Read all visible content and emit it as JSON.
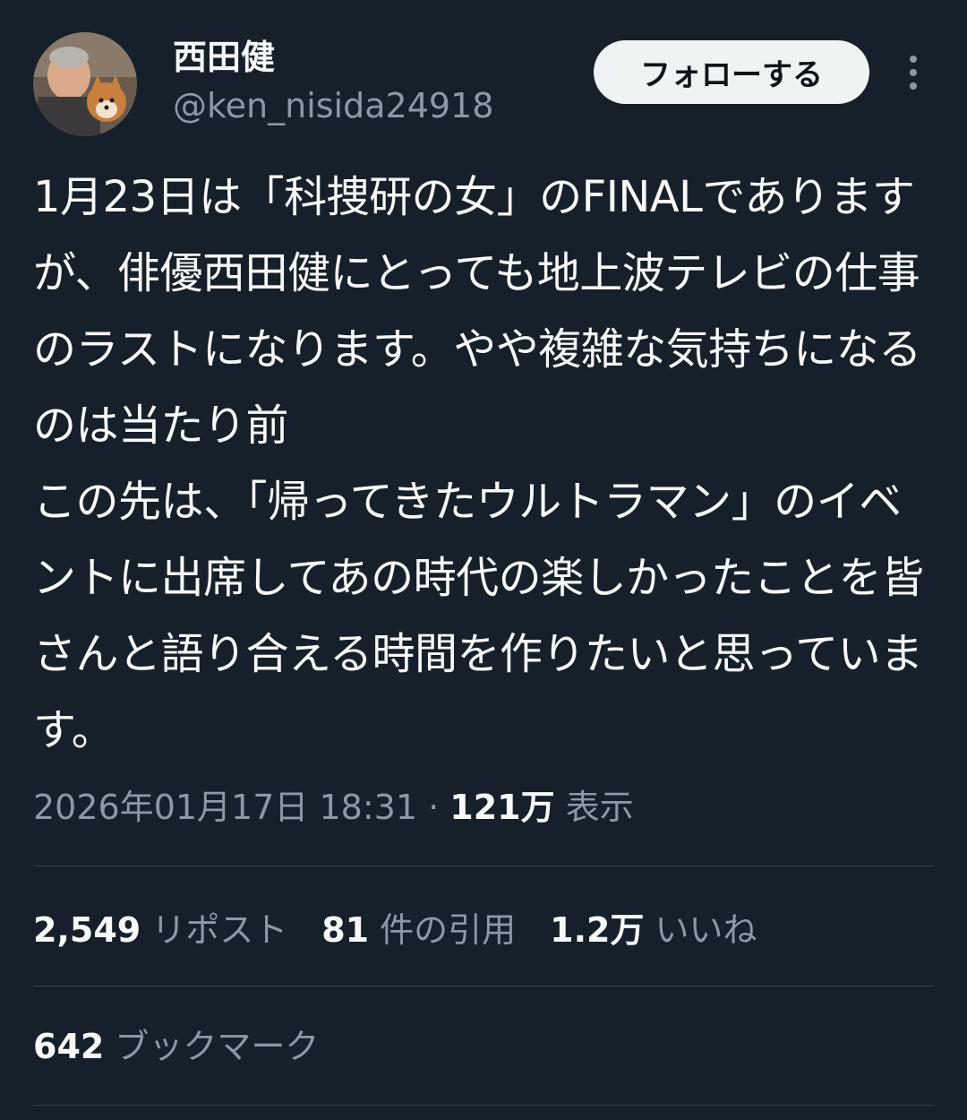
{
  "author": {
    "display_name": "西田健",
    "handle": "@ken_nisida24918",
    "avatar_icon": "profile-photo-with-dog"
  },
  "actions": {
    "follow_label": "フォローする",
    "more_icon": "more-vertical-icon"
  },
  "tweet": {
    "text": "1月23日は「科捜研の女」のFINALでありますが、俳優西田健にとっても地上波テレビの仕事のラストになります。やや複雑な気持ちになるのは当たり前\nこの先は、「帰ってきたウルトラマン」のイベントに出席してあの時代の楽しかったことを皆さんと語り合える時間を作りたいと思っています。"
  },
  "meta": {
    "timestamp": "2026年01月17日 18:31",
    "separator": "·",
    "views_count": "121万",
    "views_label": "表示"
  },
  "stats": {
    "reposts_count": "2,549",
    "reposts_label": "リポスト",
    "quotes_count": "81",
    "quotes_label": "件の引用",
    "likes_count": "1.2万",
    "likes_label": "いいね",
    "bookmarks_count": "642",
    "bookmarks_label": "ブックマーク"
  },
  "colors": {
    "background": "#15202b",
    "text_primary": "#f7f9f9",
    "text_secondary": "#8b98a5",
    "divider": "#38444d",
    "follow_button_bg": "#eff3f4"
  }
}
